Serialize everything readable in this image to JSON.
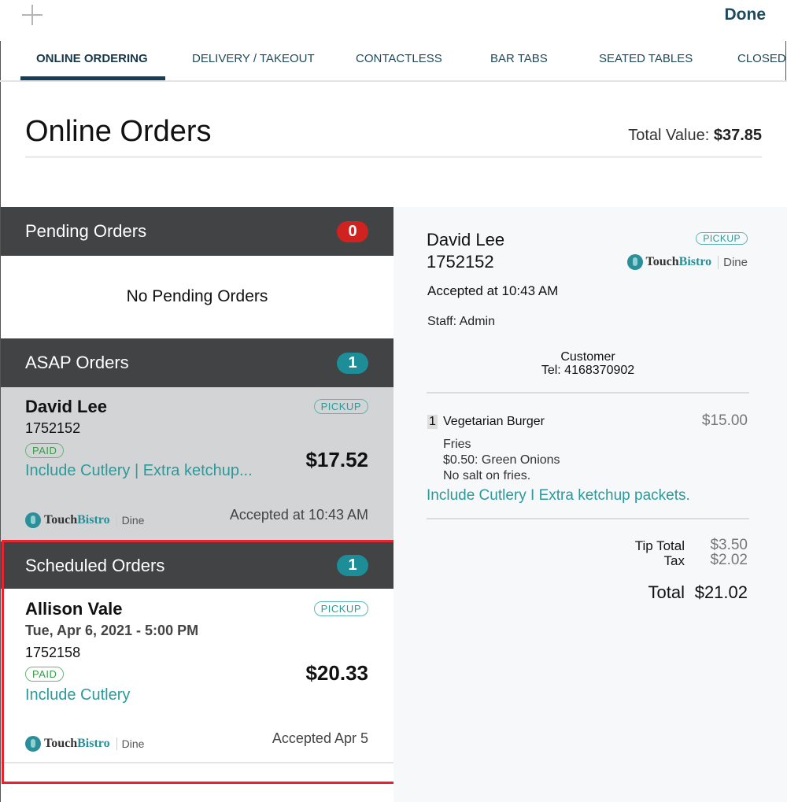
{
  "topbar": {
    "add_icon": "plus-icon",
    "done_label": "Done"
  },
  "tabs": [
    {
      "label": "ONLINE ORDERING",
      "active": true
    },
    {
      "label": "DELIVERY / TAKEOUT"
    },
    {
      "label": "CONTACTLESS"
    },
    {
      "label": "BAR TABS"
    },
    {
      "label": "SEATED TABLES"
    },
    {
      "label": "CLOSED"
    }
  ],
  "page": {
    "title": "Online Orders",
    "total_label": "Total Value:",
    "total_value": "$37.85"
  },
  "pending": {
    "title": "Pending Orders",
    "count": "0",
    "empty_text": "No Pending Orders",
    "badge_color": "#d0221f"
  },
  "asap": {
    "title": "ASAP Orders",
    "count": "1",
    "badge_color": "#1d8d97",
    "order": {
      "name": "David Lee",
      "type": "PICKUP",
      "number": "1752152",
      "status": "PAID",
      "notes": "Include Cutlery | Extra ketchup...",
      "amount": "$17.52",
      "brand_a": "Touch",
      "brand_b": "Bistro",
      "brand_c": "Dine",
      "accepted": "Accepted at 10:43 AM"
    }
  },
  "scheduled": {
    "title": "Scheduled Orders",
    "count": "1",
    "order": {
      "name": "Allison Vale",
      "date": "Tue, Apr 6, 2021 - 5:00 PM",
      "type": "PICKUP",
      "number": "1752158",
      "status": "PAID",
      "notes": "Include Cutlery",
      "amount": "$20.33",
      "brand_a": "Touch",
      "brand_b": "Bistro",
      "brand_c": "Dine",
      "accepted": "Accepted Apr 5"
    }
  },
  "detail": {
    "name": "David Lee",
    "number": "1752152",
    "type": "PICKUP",
    "brand_a": "Touch",
    "brand_b": "Bistro",
    "brand_c": "Dine",
    "accepted": "Accepted at 10:43 AM",
    "staff": "Staff: Admin",
    "customer": "Customer",
    "tel": "Tel: 4168370902",
    "item": {
      "qty": "1",
      "name": "Vegetarian Burger",
      "price": "$15.00",
      "mods": [
        "Fries",
        "$0.50: Green Onions",
        "No salt on fries."
      ]
    },
    "notes": "Include Cutlery I Extra ketchup packets.",
    "tip_label": "Tip Total",
    "tip": "$3.50",
    "tax_label": "Tax",
    "tax": "$2.02",
    "total_label": "Total",
    "total": "$21.02"
  },
  "colors": {
    "accent": "#2b9a9a",
    "header": "#414345",
    "highlight": "#e8232f"
  }
}
